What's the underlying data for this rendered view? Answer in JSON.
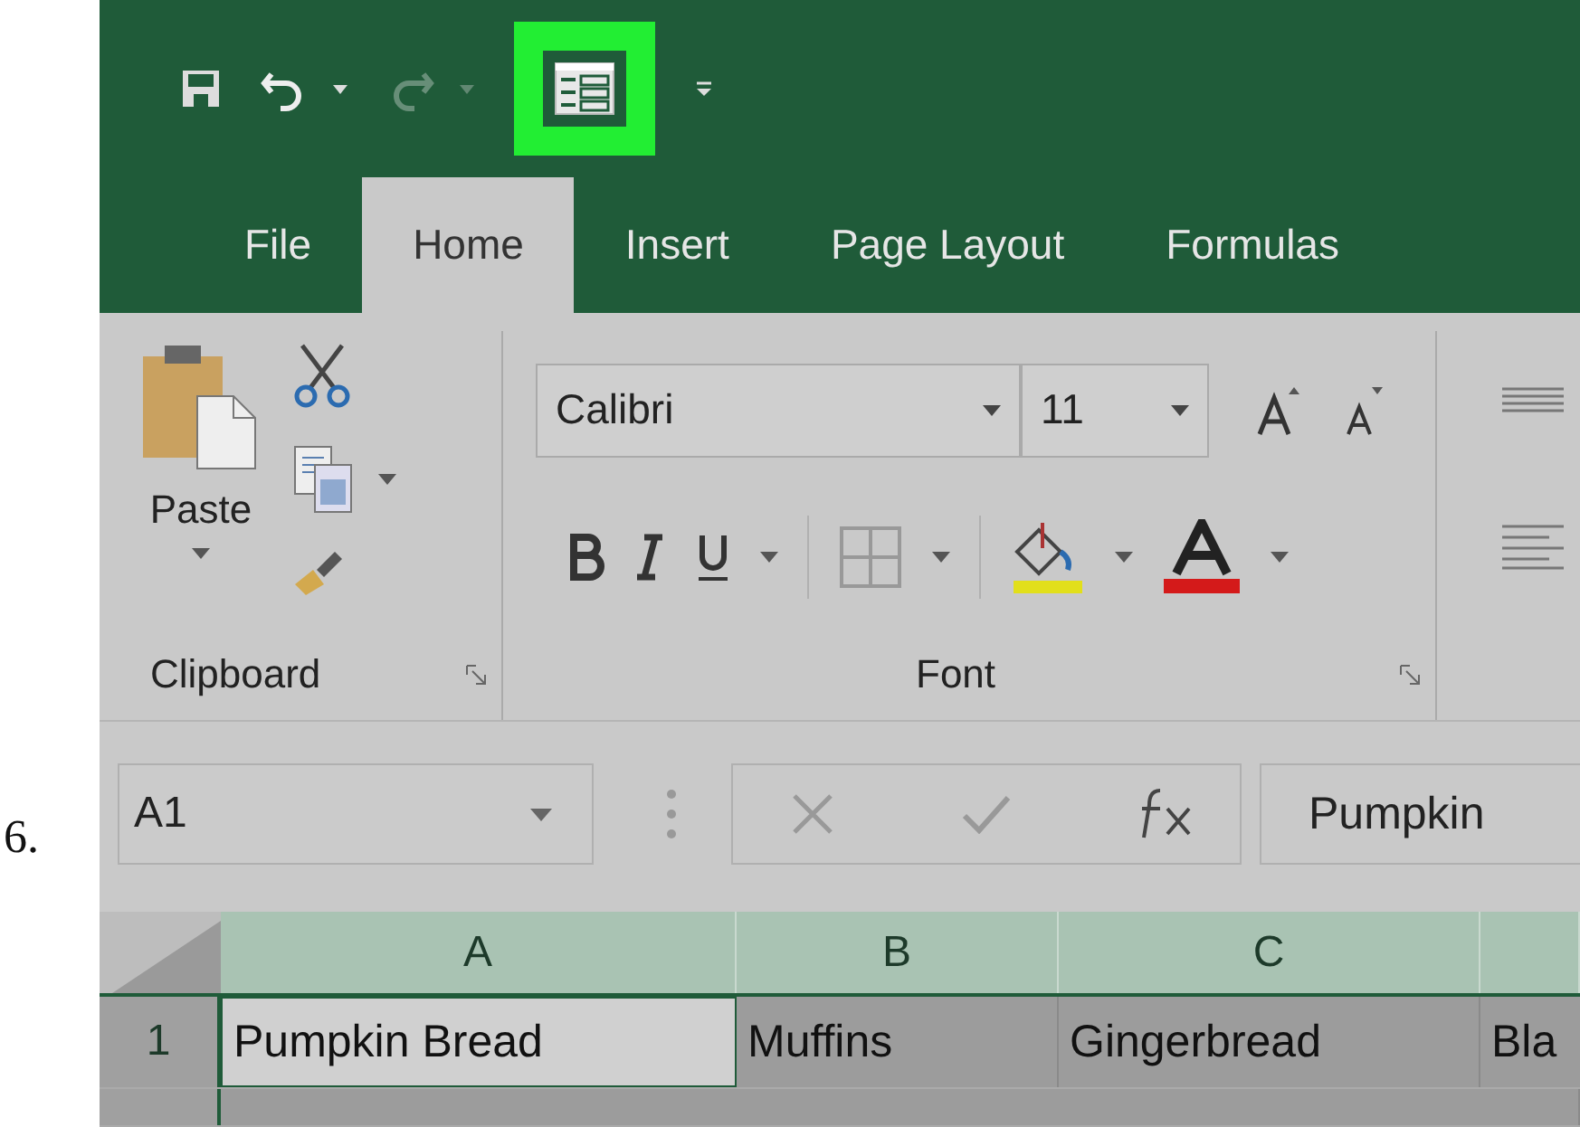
{
  "step_number": "6.",
  "quick_access": [
    {
      "kind": "save",
      "disabled": false,
      "highlighted": false
    },
    {
      "kind": "undo",
      "disabled": false,
      "highlighted": false
    },
    {
      "kind": "redo",
      "disabled": true,
      "highlighted": false
    },
    {
      "kind": "form",
      "disabled": false,
      "highlighted": true
    },
    {
      "kind": "customize",
      "disabled": false,
      "highlighted": false
    }
  ],
  "tabs": [
    {
      "label": "File",
      "selected": false
    },
    {
      "label": "Home",
      "selected": true
    },
    {
      "label": "Insert",
      "selected": false
    },
    {
      "label": "Page Layout",
      "selected": false
    },
    {
      "label": "Formulas",
      "selected": false
    }
  ],
  "clipboard_group": {
    "paste_label": "Paste",
    "label": "Clipboard"
  },
  "font_group": {
    "font_name": "Calibri",
    "font_size": "11",
    "label": "Font"
  },
  "formula_bar": {
    "name_box": "A1",
    "content": "Pumpkin"
  },
  "columns": [
    "A",
    "B",
    "C"
  ],
  "rows": [
    {
      "header": "1",
      "cells": [
        {
          "text": "Pumpkin Bread",
          "active": true
        },
        {
          "text": "Muffins",
          "active": false
        },
        {
          "text": "Gingerbread",
          "active": false
        },
        {
          "text": "Bla",
          "active": false
        }
      ]
    }
  ]
}
